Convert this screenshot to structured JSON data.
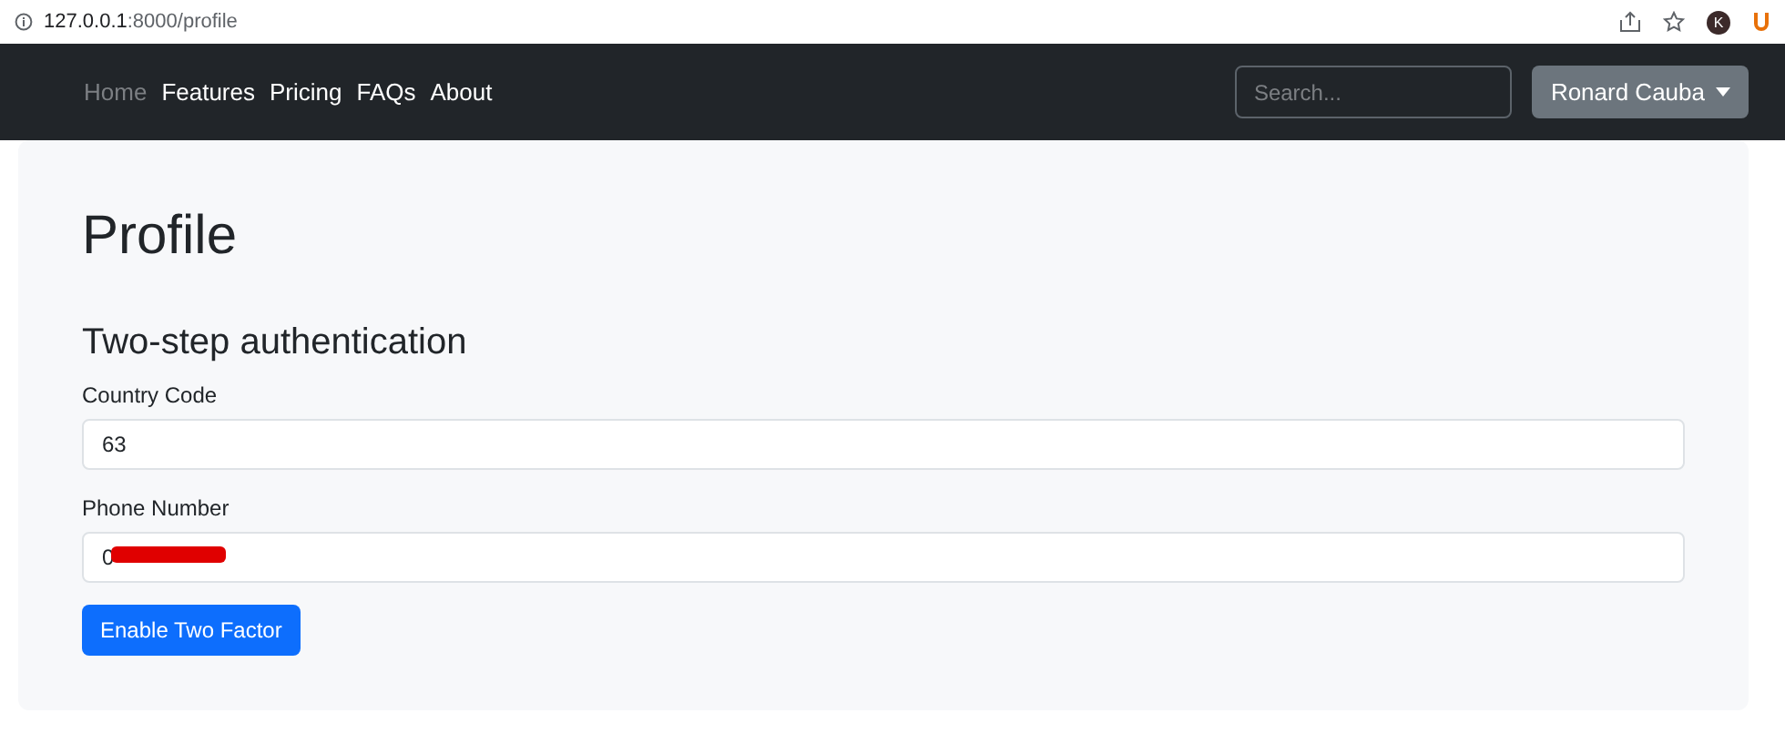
{
  "browser": {
    "url_host": "127.0.0.1",
    "url_rest": ":8000/profile",
    "profile_letter": "K"
  },
  "navbar": {
    "links": [
      {
        "label": "Home",
        "disabled": true
      },
      {
        "label": "Features",
        "disabled": false
      },
      {
        "label": "Pricing",
        "disabled": false
      },
      {
        "label": "FAQs",
        "disabled": false
      },
      {
        "label": "About",
        "disabled": false
      }
    ],
    "search": {
      "placeholder": "Search..."
    },
    "user_menu": {
      "label": "Ronard Cauba"
    }
  },
  "page": {
    "title": "Profile",
    "section_title": "Two-step authentication",
    "fields": [
      {
        "label": "Country Code",
        "value": "63",
        "redacted": false
      },
      {
        "label": "Phone Number",
        "value": "0",
        "redacted": true
      }
    ],
    "button": "Enable Two Factor"
  }
}
